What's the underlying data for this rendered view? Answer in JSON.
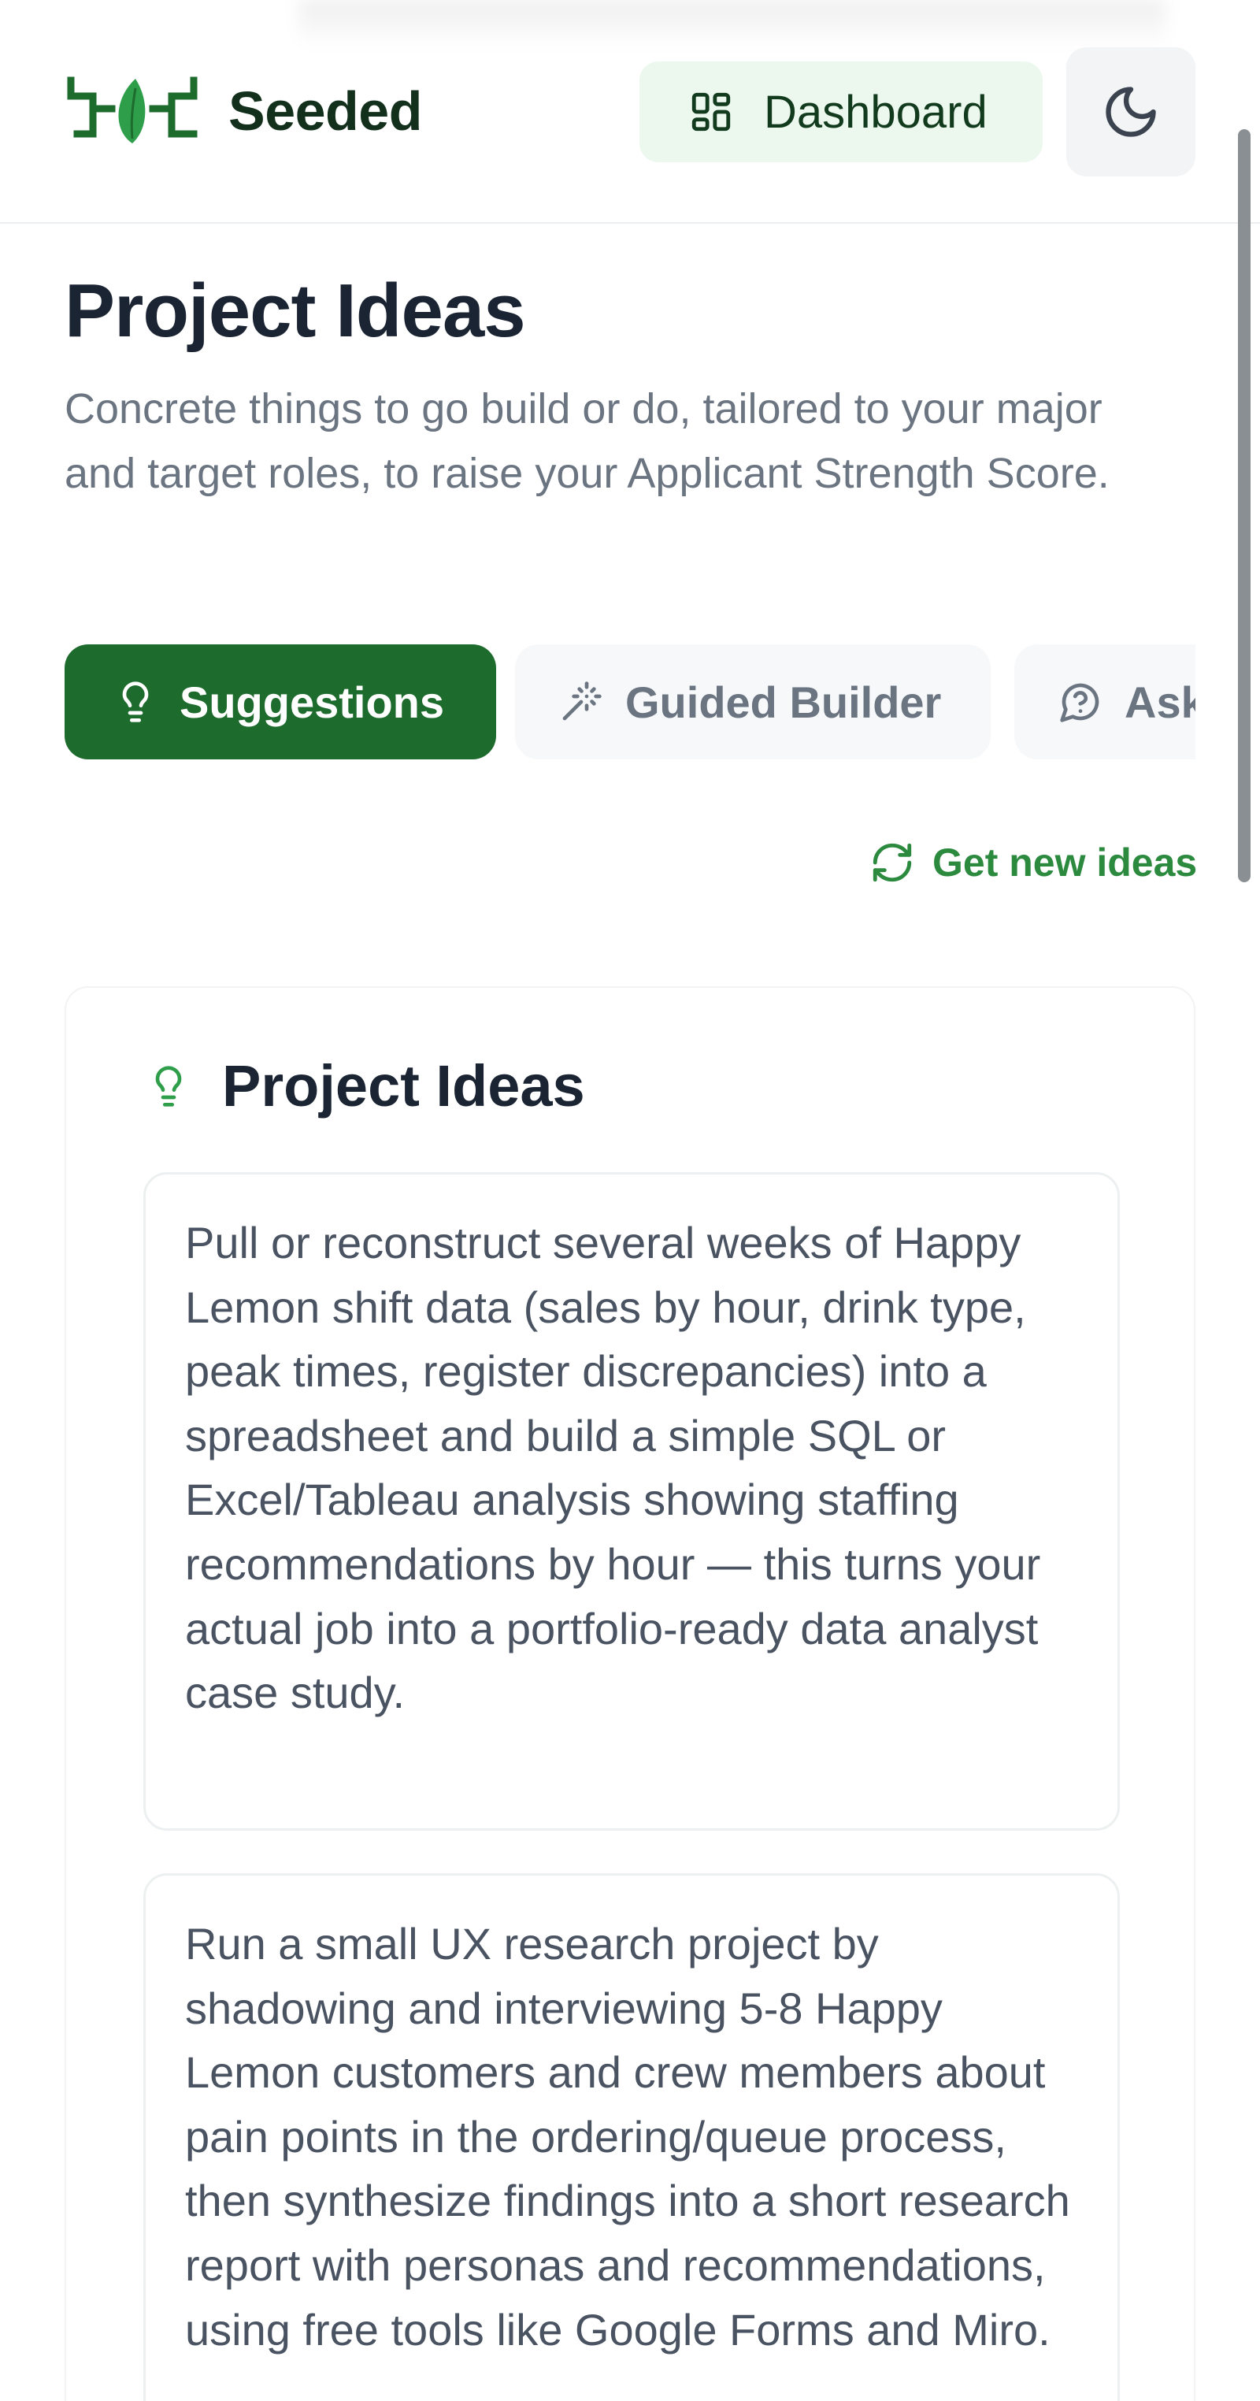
{
  "header": {
    "brand_name": "Seeded",
    "dashboard_label": "Dashboard",
    "dashboard_icon": "dashboard-grid-icon",
    "theme_icon": "moon-icon"
  },
  "page": {
    "title": "Project Ideas",
    "subtitle": "Concrete things to go build or do, tailored to your major and target roles, to raise your Applicant Strength Score."
  },
  "tabs": [
    {
      "label": "Suggestions",
      "icon": "lightbulb-icon",
      "active": true
    },
    {
      "label": "Guided Builder",
      "icon": "magic-wand-icon",
      "active": false
    },
    {
      "label": "Ask",
      "icon": "chat-question-icon",
      "active": false
    }
  ],
  "actions": {
    "new_ideas_label": "Get new ideas",
    "new_ideas_icon": "refresh-icon"
  },
  "ideas_section": {
    "title": "Project Ideas",
    "icon": "lightbulb-icon",
    "ideas": [
      "Pull or reconstruct several weeks of Happy Lemon shift data (sales by hour, drink type, peak times, register discrepancies) into a spreadsheet and build a simple SQL or Excel/Tableau analysis showing staffing recommendations by hour — this turns your actual job into a portfolio-ready data analyst case study.",
      "Run a small UX research project by shadowing and interviewing 5-8 Happy Lemon customers and crew members about pain points in the ordering/queue process, then synthesize findings into a short research report with personas and recommendations, using free tools like Google Forms and Miro."
    ]
  },
  "colors": {
    "brand_green": "#1e6b2e",
    "accent_green": "#2c8a3f",
    "dashboard_bg": "#ecf8ee",
    "text_dark": "#1b2433",
    "text_muted": "#6b7481"
  }
}
